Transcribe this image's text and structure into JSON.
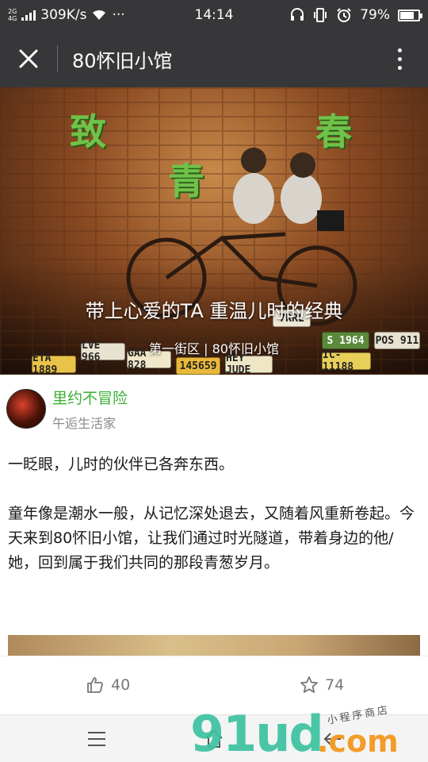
{
  "status_bar": {
    "network_top": "2G",
    "network_mid": "4G",
    "network_bot": "2G",
    "speed": "309K/s",
    "dots": "···",
    "time": "14:14",
    "battery_text": "79%",
    "battery_level": 0.79
  },
  "title_bar": {
    "title": "80怀旧小馆"
  },
  "hero": {
    "char_1": "致",
    "char_2": "青",
    "char_3": "春",
    "title": "带上心爱的TA 重温儿时的经典",
    "subtitle": "第一街区 | 80怀旧小馆",
    "plates": [
      "ETA 1889",
      "LVE 966",
      "GAA 828",
      "145659",
      "HEY JUDE",
      "IC-11188",
      "S 1964",
      "POS 911",
      "7RRL"
    ]
  },
  "author": {
    "name": "里约不冒险",
    "subtitle": "午逅生活家"
  },
  "article": {
    "paragraph_1": "一眨眼，儿时的伙伴已各奔东西。",
    "paragraph_2": "童年像是潮水一般，从记忆深处退去，又随着风重新卷起。今天来到80怀旧小馆，让我们通过时光隧道，带着身边的他/她，回到属于我们共同的那段青葱岁月。"
  },
  "actions": {
    "like_count": "40",
    "star_count": "74"
  },
  "watermark": {
    "main": "91ud",
    "com": ".com",
    "small": "小程序商店"
  },
  "colors": {
    "title_bar_bg": "#373739",
    "author_name": "#3cb035"
  },
  "icons": [
    "close-icon",
    "more-vertical-icon",
    "thumbs-up-icon",
    "star-icon",
    "menu-icon",
    "home-icon",
    "back-icon",
    "wifi-icon",
    "headset-icon",
    "vibrate-icon",
    "alarm-icon",
    "battery-icon"
  ]
}
